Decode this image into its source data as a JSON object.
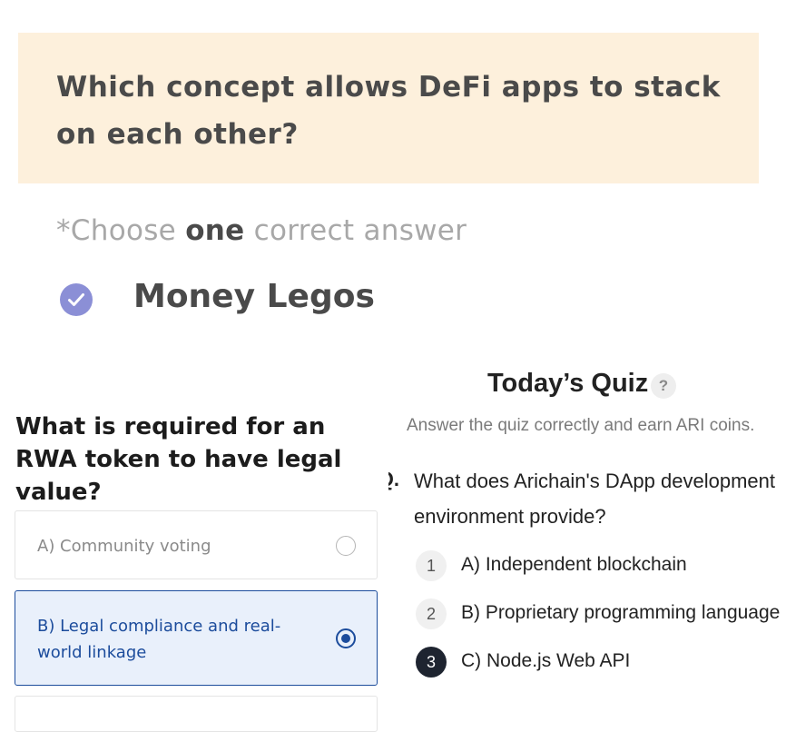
{
  "card1": {
    "question": "Which concept allows DeFi apps to stack on each other?",
    "instruction_pre": "*Choose ",
    "instruction_emphasis": "one",
    "instruction_post": " correct answer",
    "selected_answer": "Money Legos",
    "accent_color": "#8b8fd6",
    "background_color": "#fdf0dc",
    "icon": "check-circle-icon"
  },
  "card2": {
    "question": "What is required for an RWA token to have legal value?",
    "options": [
      {
        "label": "A) Community voting",
        "selected": false
      },
      {
        "label": "B) Legal compliance and real-world linkage",
        "selected": true
      }
    ],
    "accent_color": "#1c4c9c"
  },
  "card3": {
    "header": "Today’s Quiz",
    "help_symbol": "?",
    "subtitle": "Answer the quiz correctly and earn ARI coins.",
    "question_number_fragment": "Q.",
    "question": "What does Arichain's DApp development environment provide?",
    "options": [
      {
        "num": "1",
        "label": "A) Independent blockchain",
        "selected": false
      },
      {
        "num": "2",
        "label": "B) Proprietary programming language",
        "selected": false
      },
      {
        "num": "3",
        "label": "C) Node.js Web API",
        "selected": true
      }
    ]
  }
}
